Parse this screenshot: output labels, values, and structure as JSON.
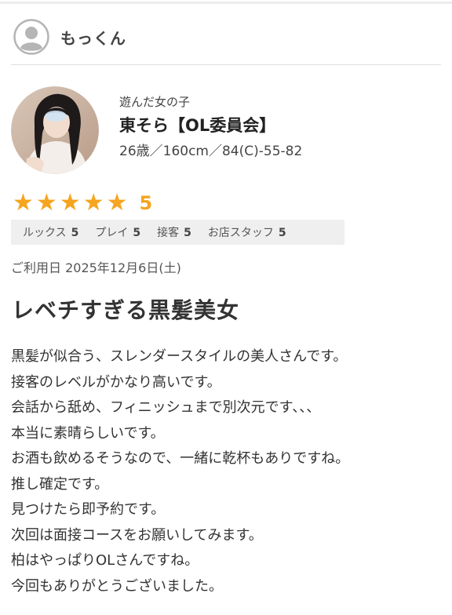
{
  "reviewer": {
    "name": "もっくん",
    "avatar_icon": "user-circle-icon"
  },
  "girl": {
    "label": "遊んだ女の子",
    "name": "東そら【OL委員会】",
    "stats": "26歳／160cm／84(C)-55-82",
    "photo_icon": "portrait-photo"
  },
  "rating": {
    "stars": 5,
    "max_stars": 5,
    "score": "5",
    "star_color": "#f5a51f",
    "items": [
      {
        "label": "ルックス",
        "score": "5"
      },
      {
        "label": "プレイ",
        "score": "5"
      },
      {
        "label": "接客",
        "score": "5"
      },
      {
        "label": "お店スタッフ",
        "score": "5"
      }
    ]
  },
  "visit_date": "ご利用日 2025年12月6日(土)",
  "review": {
    "title": "レベチすぎる黒髪美女",
    "lines": [
      "黒髪が似合う、スレンダースタイルの美人さんです。",
      "接客のレベルがかなり高いです。",
      "会話から舐め、フィニッシュまで別次元です、、、",
      "本当に素晴らしいです。",
      "お酒も飲めるそうなので、一緒に乾杯もありですね。",
      "推し確定です。",
      "見つけたら即予約です。",
      "次回は面接コースをお願いしてみます。",
      "柏はやっぱりOLさんですね。",
      "今回もありがとうございました。"
    ]
  }
}
